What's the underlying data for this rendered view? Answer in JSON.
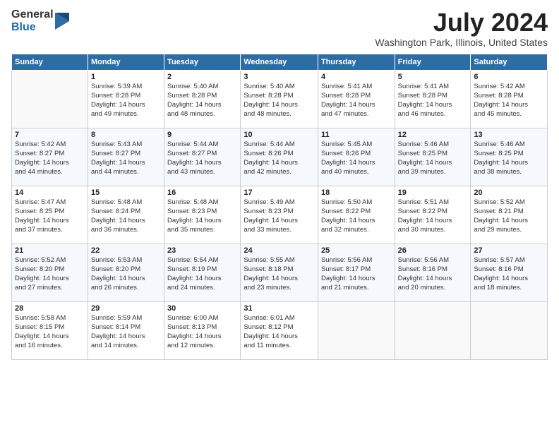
{
  "logo": {
    "general": "General",
    "blue": "Blue"
  },
  "title": "July 2024",
  "location": "Washington Park, Illinois, United States",
  "headers": [
    "Sunday",
    "Monday",
    "Tuesday",
    "Wednesday",
    "Thursday",
    "Friday",
    "Saturday"
  ],
  "weeks": [
    [
      {
        "day": "",
        "info": ""
      },
      {
        "day": "1",
        "info": "Sunrise: 5:39 AM\nSunset: 8:28 PM\nDaylight: 14 hours\nand 49 minutes."
      },
      {
        "day": "2",
        "info": "Sunrise: 5:40 AM\nSunset: 8:28 PM\nDaylight: 14 hours\nand 48 minutes."
      },
      {
        "day": "3",
        "info": "Sunrise: 5:40 AM\nSunset: 8:28 PM\nDaylight: 14 hours\nand 48 minutes."
      },
      {
        "day": "4",
        "info": "Sunrise: 5:41 AM\nSunset: 8:28 PM\nDaylight: 14 hours\nand 47 minutes."
      },
      {
        "day": "5",
        "info": "Sunrise: 5:41 AM\nSunset: 8:28 PM\nDaylight: 14 hours\nand 46 minutes."
      },
      {
        "day": "6",
        "info": "Sunrise: 5:42 AM\nSunset: 8:28 PM\nDaylight: 14 hours\nand 45 minutes."
      }
    ],
    [
      {
        "day": "7",
        "info": "Sunrise: 5:42 AM\nSunset: 8:27 PM\nDaylight: 14 hours\nand 44 minutes."
      },
      {
        "day": "8",
        "info": "Sunrise: 5:43 AM\nSunset: 8:27 PM\nDaylight: 14 hours\nand 44 minutes."
      },
      {
        "day": "9",
        "info": "Sunrise: 5:44 AM\nSunset: 8:27 PM\nDaylight: 14 hours\nand 43 minutes."
      },
      {
        "day": "10",
        "info": "Sunrise: 5:44 AM\nSunset: 8:26 PM\nDaylight: 14 hours\nand 42 minutes."
      },
      {
        "day": "11",
        "info": "Sunrise: 5:45 AM\nSunset: 8:26 PM\nDaylight: 14 hours\nand 40 minutes."
      },
      {
        "day": "12",
        "info": "Sunrise: 5:46 AM\nSunset: 8:25 PM\nDaylight: 14 hours\nand 39 minutes."
      },
      {
        "day": "13",
        "info": "Sunrise: 5:46 AM\nSunset: 8:25 PM\nDaylight: 14 hours\nand 38 minutes."
      }
    ],
    [
      {
        "day": "14",
        "info": "Sunrise: 5:47 AM\nSunset: 8:25 PM\nDaylight: 14 hours\nand 37 minutes."
      },
      {
        "day": "15",
        "info": "Sunrise: 5:48 AM\nSunset: 8:24 PM\nDaylight: 14 hours\nand 36 minutes."
      },
      {
        "day": "16",
        "info": "Sunrise: 5:48 AM\nSunset: 8:23 PM\nDaylight: 14 hours\nand 35 minutes."
      },
      {
        "day": "17",
        "info": "Sunrise: 5:49 AM\nSunset: 8:23 PM\nDaylight: 14 hours\nand 33 minutes."
      },
      {
        "day": "18",
        "info": "Sunrise: 5:50 AM\nSunset: 8:22 PM\nDaylight: 14 hours\nand 32 minutes."
      },
      {
        "day": "19",
        "info": "Sunrise: 5:51 AM\nSunset: 8:22 PM\nDaylight: 14 hours\nand 30 minutes."
      },
      {
        "day": "20",
        "info": "Sunrise: 5:52 AM\nSunset: 8:21 PM\nDaylight: 14 hours\nand 29 minutes."
      }
    ],
    [
      {
        "day": "21",
        "info": "Sunrise: 5:52 AM\nSunset: 8:20 PM\nDaylight: 14 hours\nand 27 minutes."
      },
      {
        "day": "22",
        "info": "Sunrise: 5:53 AM\nSunset: 8:20 PM\nDaylight: 14 hours\nand 26 minutes."
      },
      {
        "day": "23",
        "info": "Sunrise: 5:54 AM\nSunset: 8:19 PM\nDaylight: 14 hours\nand 24 minutes."
      },
      {
        "day": "24",
        "info": "Sunrise: 5:55 AM\nSunset: 8:18 PM\nDaylight: 14 hours\nand 23 minutes."
      },
      {
        "day": "25",
        "info": "Sunrise: 5:56 AM\nSunset: 8:17 PM\nDaylight: 14 hours\nand 21 minutes."
      },
      {
        "day": "26",
        "info": "Sunrise: 5:56 AM\nSunset: 8:16 PM\nDaylight: 14 hours\nand 20 minutes."
      },
      {
        "day": "27",
        "info": "Sunrise: 5:57 AM\nSunset: 8:16 PM\nDaylight: 14 hours\nand 18 minutes."
      }
    ],
    [
      {
        "day": "28",
        "info": "Sunrise: 5:58 AM\nSunset: 8:15 PM\nDaylight: 14 hours\nand 16 minutes."
      },
      {
        "day": "29",
        "info": "Sunrise: 5:59 AM\nSunset: 8:14 PM\nDaylight: 14 hours\nand 14 minutes."
      },
      {
        "day": "30",
        "info": "Sunrise: 6:00 AM\nSunset: 8:13 PM\nDaylight: 14 hours\nand 12 minutes."
      },
      {
        "day": "31",
        "info": "Sunrise: 6:01 AM\nSunset: 8:12 PM\nDaylight: 14 hours\nand 11 minutes."
      },
      {
        "day": "",
        "info": ""
      },
      {
        "day": "",
        "info": ""
      },
      {
        "day": "",
        "info": ""
      }
    ]
  ]
}
